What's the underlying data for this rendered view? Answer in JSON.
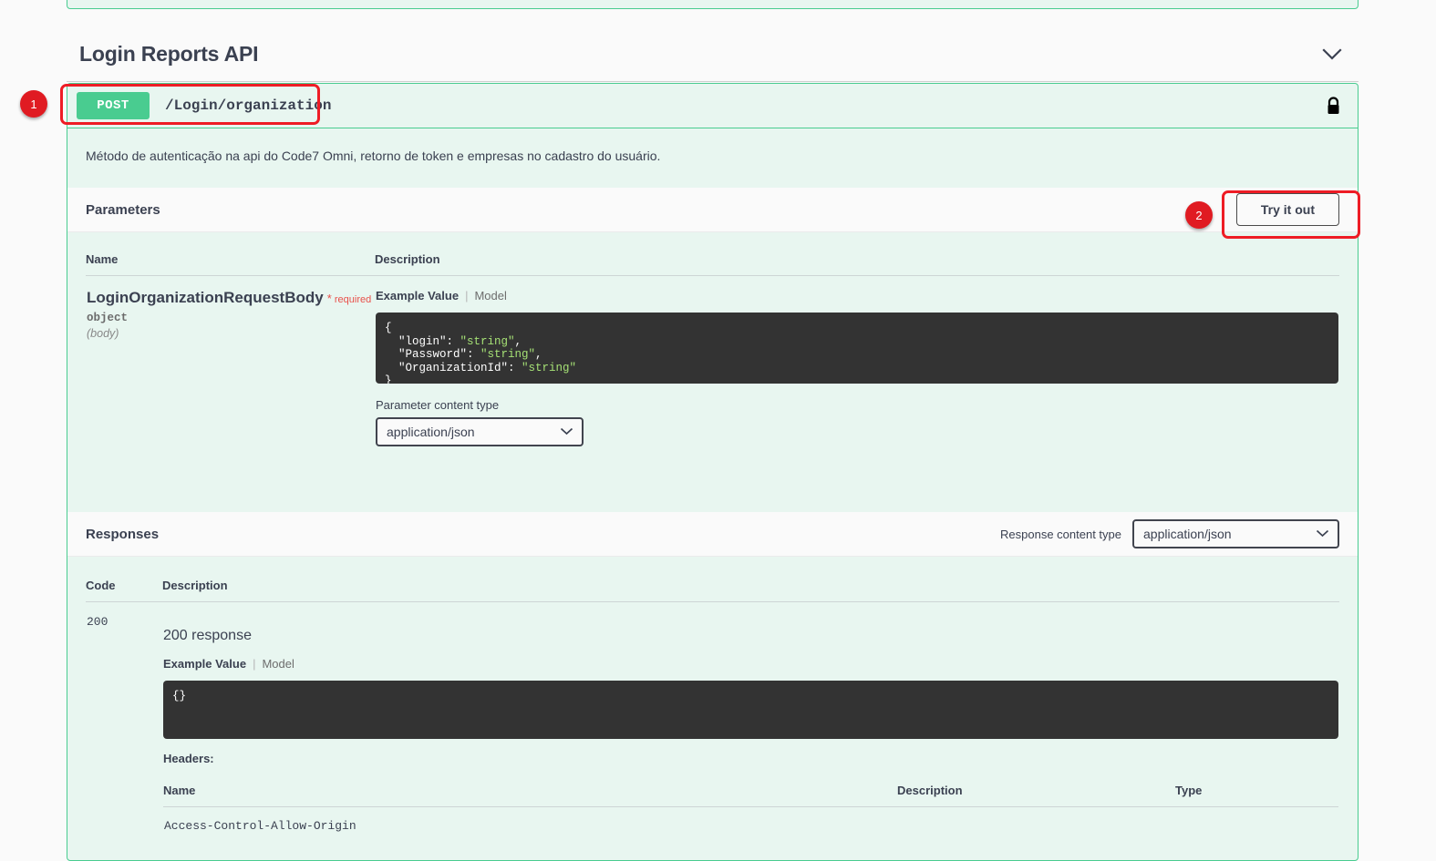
{
  "section": {
    "title": "Login Reports API",
    "collapse_icon": "chevron-down-icon"
  },
  "operation": {
    "method": "POST",
    "path": "/Login/organization",
    "auth_icon": "lock-icon",
    "description": "Método de autenticação na api do Code7 Omni, retorno de token e empresas no cadastro do usuário."
  },
  "parameters": {
    "heading": "Parameters",
    "try_it_out_label": "Try it out",
    "columns": {
      "name": "Name",
      "description": "Description"
    },
    "row": {
      "name": "LoginOrganizationRequestBody",
      "required_star": "*",
      "required_text": "required",
      "type": "object",
      "location": "(body)",
      "example_tab": "Example Value",
      "model_tab": "Model",
      "example_code": "{\n  \"login\": \"string\",\n  \"Password\": \"string\",\n  \"OrganizationId\": \"string\"\n}",
      "content_type_label": "Parameter content type",
      "content_type_value": "application/json",
      "content_type_options": [
        "application/json"
      ]
    }
  },
  "responses": {
    "heading": "Responses",
    "content_type_label": "Response content type",
    "content_type_value": "application/json",
    "content_type_options": [
      "application/json"
    ],
    "columns": {
      "code": "Code",
      "description": "Description"
    },
    "items": [
      {
        "code": "200",
        "title": "200 response",
        "example_tab": "Example Value",
        "model_tab": "Model",
        "example_code": "{}",
        "headers_label": "Headers:",
        "headers_columns": {
          "name": "Name",
          "description": "Description",
          "type": "Type"
        },
        "headers_rows": [
          {
            "name": "Access-Control-Allow-Origin",
            "description": "",
            "type": ""
          }
        ]
      }
    ]
  },
  "annotations": [
    {
      "id": "1",
      "target": "post-login-organization-operation"
    },
    {
      "id": "2",
      "target": "try-it-out-button"
    }
  ],
  "colors": {
    "method_green": "#49cc90",
    "block_bg": "#e8f6f0",
    "annotation_red": "#ee1c25",
    "code_bg": "#333333",
    "required_red": "#e8504a"
  }
}
